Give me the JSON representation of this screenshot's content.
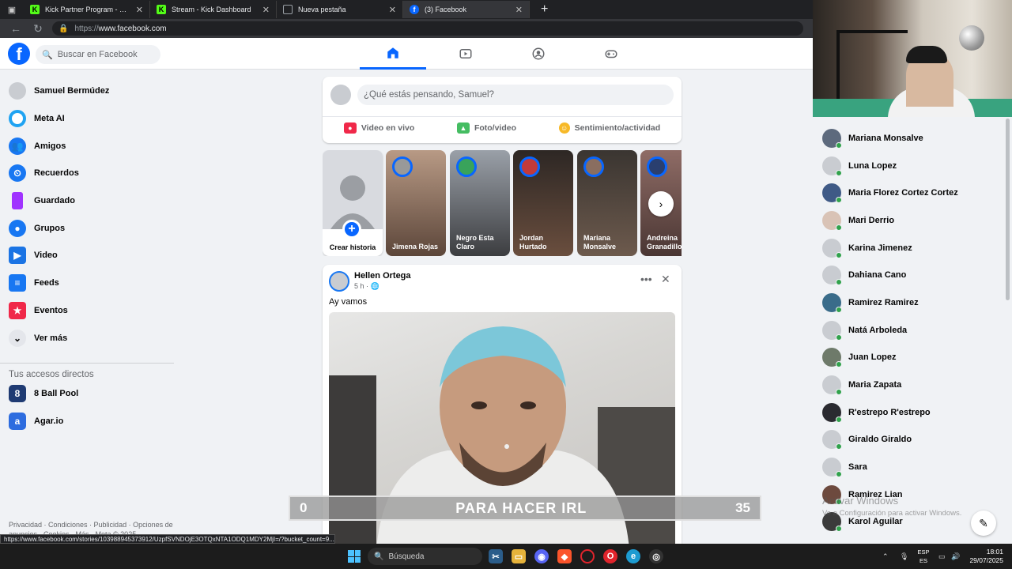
{
  "browser": {
    "tabs": [
      {
        "title": "Kick Partner Program - Kick Dash",
        "icon": "kick-icon",
        "color": "#53fc18",
        "active": false
      },
      {
        "title": "Stream - Kick Dashboard",
        "icon": "kick-icon",
        "color": "#53fc18",
        "active": false
      },
      {
        "title": "Nueva pestaña",
        "icon": "new-tab-icon",
        "color": "#9aa0a6",
        "active": false
      },
      {
        "title": "(3) Facebook",
        "icon": "facebook-icon",
        "color": "#0866ff",
        "active": true
      }
    ],
    "url_prefix": "https://",
    "url_host": "www.facebook.com"
  },
  "header": {
    "search_placeholder": "Buscar en Facebook",
    "nav": [
      {
        "name": "home",
        "icon": "home-icon",
        "active": true
      },
      {
        "name": "video",
        "icon": "video-icon",
        "active": false
      },
      {
        "name": "groups",
        "icon": "groups-icon",
        "active": false
      },
      {
        "name": "gaming",
        "icon": "gaming-icon",
        "active": false
      }
    ]
  },
  "sidebar": {
    "items": [
      {
        "label": "Samuel Bermúdez",
        "icon": "avatar-icon",
        "color": "#c9ccd1"
      },
      {
        "label": "Meta AI",
        "icon": "meta-ai-icon",
        "color": "#1fa3f2"
      },
      {
        "label": "Amigos",
        "icon": "friends-icon",
        "color": "#1877f2"
      },
      {
        "label": "Recuerdos",
        "icon": "memories-icon",
        "color": "#1877f2"
      },
      {
        "label": "Guardado",
        "icon": "bookmark-icon",
        "color": "#a033ff"
      },
      {
        "label": "Grupos",
        "icon": "groups-icon",
        "color": "#1877f2"
      },
      {
        "label": "Video",
        "icon": "video-icon",
        "color": "#1b74e4"
      },
      {
        "label": "Feeds",
        "icon": "feeds-icon",
        "color": "#1877f2"
      },
      {
        "label": "Eventos",
        "icon": "events-icon",
        "color": "#f02849"
      },
      {
        "label": "Ver más",
        "icon": "chevron-down-icon",
        "color": "#e4e6eb"
      }
    ],
    "shortcuts_title": "Tus accesos directos",
    "shortcuts": [
      {
        "label": "8 Ball Pool",
        "icon": "8-ball-pool-icon",
        "color": "#1f3b73"
      },
      {
        "label": "Agar.io",
        "icon": "agario-icon",
        "color": "#2d6cdf"
      }
    ],
    "footer": "Privacidad · Condiciones · Publicidad · Opciones de anuncios · Cookies · Más · Meta © 2025"
  },
  "composer": {
    "placeholder": "¿Qué estás pensando, Samuel?",
    "actions": [
      {
        "label": "Video en vivo",
        "icon": "live-video-icon",
        "color": "#f02849"
      },
      {
        "label": "Foto/video",
        "icon": "photo-icon",
        "color": "#45bd62"
      },
      {
        "label": "Sentimiento/actividad",
        "icon": "smile-icon",
        "color": "#f7b928"
      }
    ]
  },
  "stories": {
    "create_label": "Crear historia",
    "items": [
      {
        "name": "Jimena Rojas",
        "bg": "#8c6e58"
      },
      {
        "name": "Negro Esta Claro",
        "bg": "#6e6f73"
      },
      {
        "name": "Jordan Hurtado",
        "bg": "#3b2d26"
      },
      {
        "name": "Mariana Monsalve",
        "bg": "#4a4038"
      },
      {
        "name": "Andreina Granadillo",
        "bg": "#7b5b55"
      }
    ]
  },
  "post": {
    "author": "Hellen Ortega",
    "time": "5 h · 🌐",
    "text": "Ay vamos"
  },
  "overlay": {
    "left": "0",
    "title": "PARA HACER IRL",
    "right": "35"
  },
  "contacts": [
    "Mariana Monsalve",
    "Luna Lopez",
    "Maria Florez Cortez Cortez",
    "Mari Derrio",
    "Karina Jimenez",
    "Dahiana Cano",
    "Ramirez Ramirez",
    "Natá Arboleda",
    "Juan Lopez",
    "Maria Zapata",
    "R'estrepo R'estrepo",
    "Giraldo Giraldo",
    "Sara",
    "Ramirez Lian",
    "Karol Aguilar"
  ],
  "watermark": {
    "title": "Activar Windows",
    "sub": "Ve a Configuración para activar Windows."
  },
  "status_url": "https://www.facebook.com/stories/103988945373912/UzpfSVNDOjE3OTQxNTA1ODQ1MDY2MjI=/?bucket_count=9...",
  "taskbar": {
    "search_label": "Búsqueda",
    "lang_1": "ESP",
    "lang_2": "ES",
    "time": "18:01",
    "date": "29/07/2025"
  }
}
